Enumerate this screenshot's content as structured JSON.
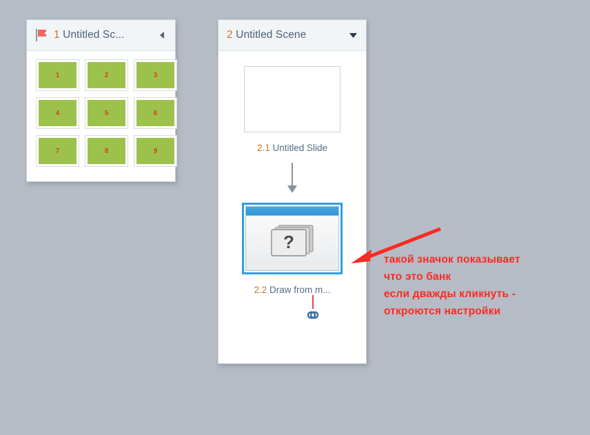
{
  "canvas": {
    "background_color": "#b5bcc6"
  },
  "scene1_panel": {
    "flag_icon": "flag-icon",
    "title_number": "1",
    "title_text": "Untitled Sc...",
    "collapse_icon": "caret-left-icon",
    "thumbnails": [
      {
        "label": "1"
      },
      {
        "label": "2"
      },
      {
        "label": "3"
      },
      {
        "label": "4"
      },
      {
        "label": "5"
      },
      {
        "label": "6"
      },
      {
        "label": "7"
      },
      {
        "label": "8"
      },
      {
        "label": "9"
      }
    ],
    "thumbnail_fill": "#9dc24c",
    "thumbnail_label_color": "#d4431f"
  },
  "scene2_panel": {
    "title_number": "2",
    "title_text": "Untitled Scene",
    "expand_icon": "caret-down-icon",
    "slide": {
      "number": "2.1",
      "name": "Untitled Slide",
      "thumb_icon": "blank-slide-thumbnail"
    },
    "connector_icon": "arrow-down-icon",
    "bank": {
      "number": "2.2",
      "name": "Draw from m...",
      "icon": "question-card-stack-icon",
      "selected_border_color": "#2f9fe0",
      "link_icon": "chain-link-icon",
      "link_icon_color": "#3a6ea5",
      "link_stub_color": "#e04a3f"
    }
  },
  "annotation": {
    "arrow_icon": "red-arrow-left-icon",
    "arrow_color": "#fb2a22",
    "text_color": "#fb2a22",
    "lines": [
      "такой значок показывает",
      "что это банк",
      "если дважды кликнуть -",
      "откроются настройки"
    ]
  }
}
